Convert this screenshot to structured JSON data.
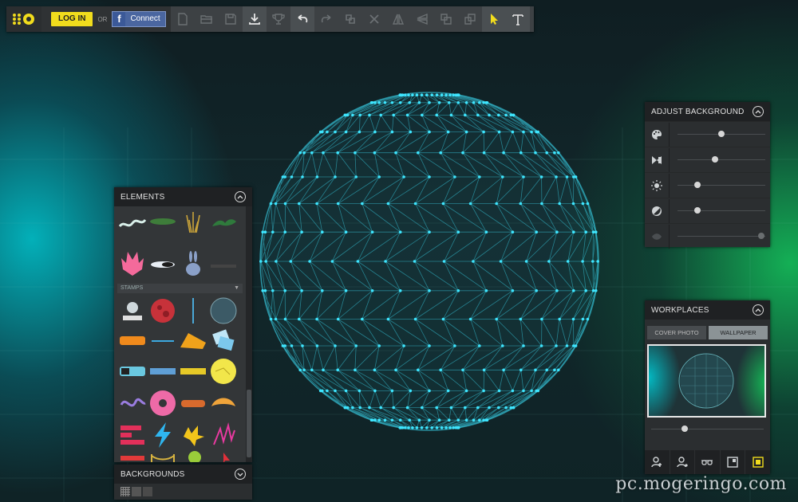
{
  "toolbar": {
    "login_label": "LOG IN",
    "or_label": "OR",
    "fb_letter": "f",
    "connect_label": "Connect",
    "tools": [
      "new-page",
      "open-folder",
      "save-disk",
      "download",
      "trophy",
      "undo",
      "redo",
      "crop",
      "delete",
      "flip-horizontal",
      "flip-vertical",
      "bring-forward",
      "send-backward",
      "pointer",
      "text"
    ]
  },
  "elements_panel": {
    "title": "ELEMENTS",
    "stamps_label": "STAMPS"
  },
  "backgrounds_panel": {
    "title": "BACKGROUNDS"
  },
  "adjust_panel": {
    "title": "ADJUST BACKGROUND",
    "rows": [
      {
        "icon": "palette-icon",
        "level": 0.5
      },
      {
        "icon": "contrast-arrows-icon",
        "level": 0.43
      },
      {
        "icon": "brightness-sun-icon",
        "level": 0.23
      },
      {
        "icon": "saturation-circle-icon",
        "level": 0.23
      },
      {
        "icon": "eye-visibility-icon",
        "level": 0.95
      }
    ]
  },
  "workplaces_panel": {
    "title": "WORKPLACES",
    "tabs": [
      "COVER PHOTO",
      "WALLPAPER"
    ],
    "active_tab": "WALLPAPER",
    "slider_level": 0.3
  },
  "colors": {
    "login_yellow": "#f1dc1d",
    "facebook_blue": "#3b5998",
    "sphere_cyan": "#3ee6ff",
    "panel_dark": "#2b2e30"
  },
  "watermark": "pc.mogeringo.com"
}
